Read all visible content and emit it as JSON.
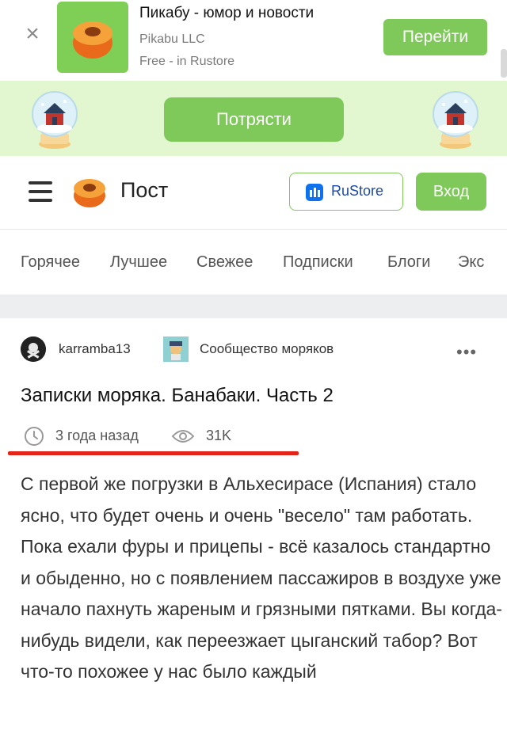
{
  "app_banner": {
    "name": "Пикабу - юмор и новости",
    "developer": "Pikabu LLC",
    "meta": "Free - in Rustore",
    "button": "Перейти",
    "close_symbol": "×"
  },
  "promo": {
    "button": "Потрясти"
  },
  "header": {
    "title": "Пост",
    "store_button": "RuStore",
    "login_button": "Вход"
  },
  "nav": {
    "items": [
      "Горячее",
      "Лучшее",
      "Свежее",
      "Подписки",
      "Блоги",
      "Экс"
    ]
  },
  "post": {
    "author": "karramba13",
    "community": "Сообщество моряков",
    "more_symbol": "•••",
    "title": "Записки моряка. Банабаки. Часть 2",
    "time": "3 года назад",
    "views": "31K",
    "paragraphs": [
      "С первой же погрузки в Альхесирасе (Испания) стало ясно, что будет очень и очень \"весело\" там работать.",
      "Пока ехали фуры и прицепы - всё казалось стандартно и обыденно, но с появлением пассажиров в воздухе уже начало пахнуть жареным и грязными пятками. Вы когда-нибудь видели, как переезжает цыганский табор? Вот что-то похожее у нас было каждый"
    ]
  },
  "colors": {
    "accent_green": "#7ec95a",
    "light_green": "#e2f6cf",
    "highlight_red": "#e32419",
    "rustore_blue": "#0f71ee"
  }
}
